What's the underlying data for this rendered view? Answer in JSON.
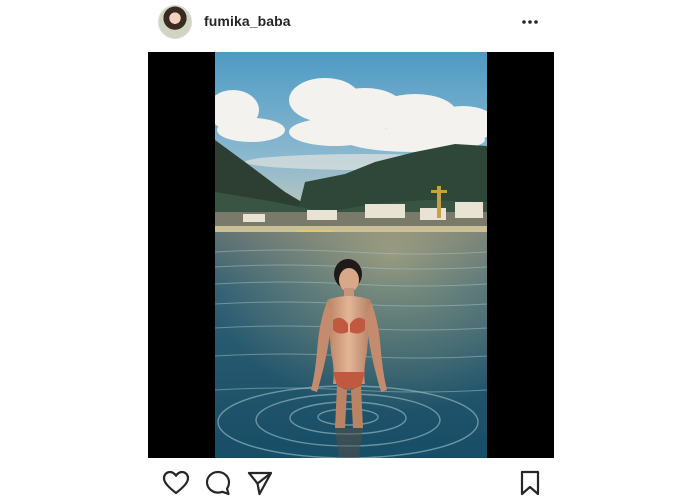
{
  "post": {
    "username": "fumika_baba",
    "avatar_icon": "avatar-photo",
    "more_icon": "more-horizontal-icon",
    "photo_description_icon": "photo",
    "actions": {
      "like_icon": "heart-icon",
      "comment_icon": "comment-bubble-icon",
      "share_icon": "paper-plane-icon",
      "save_icon": "bookmark-icon"
    }
  },
  "colors": {
    "text": "#262626",
    "border": "#dbdbdb",
    "letterbox": "#000000"
  }
}
